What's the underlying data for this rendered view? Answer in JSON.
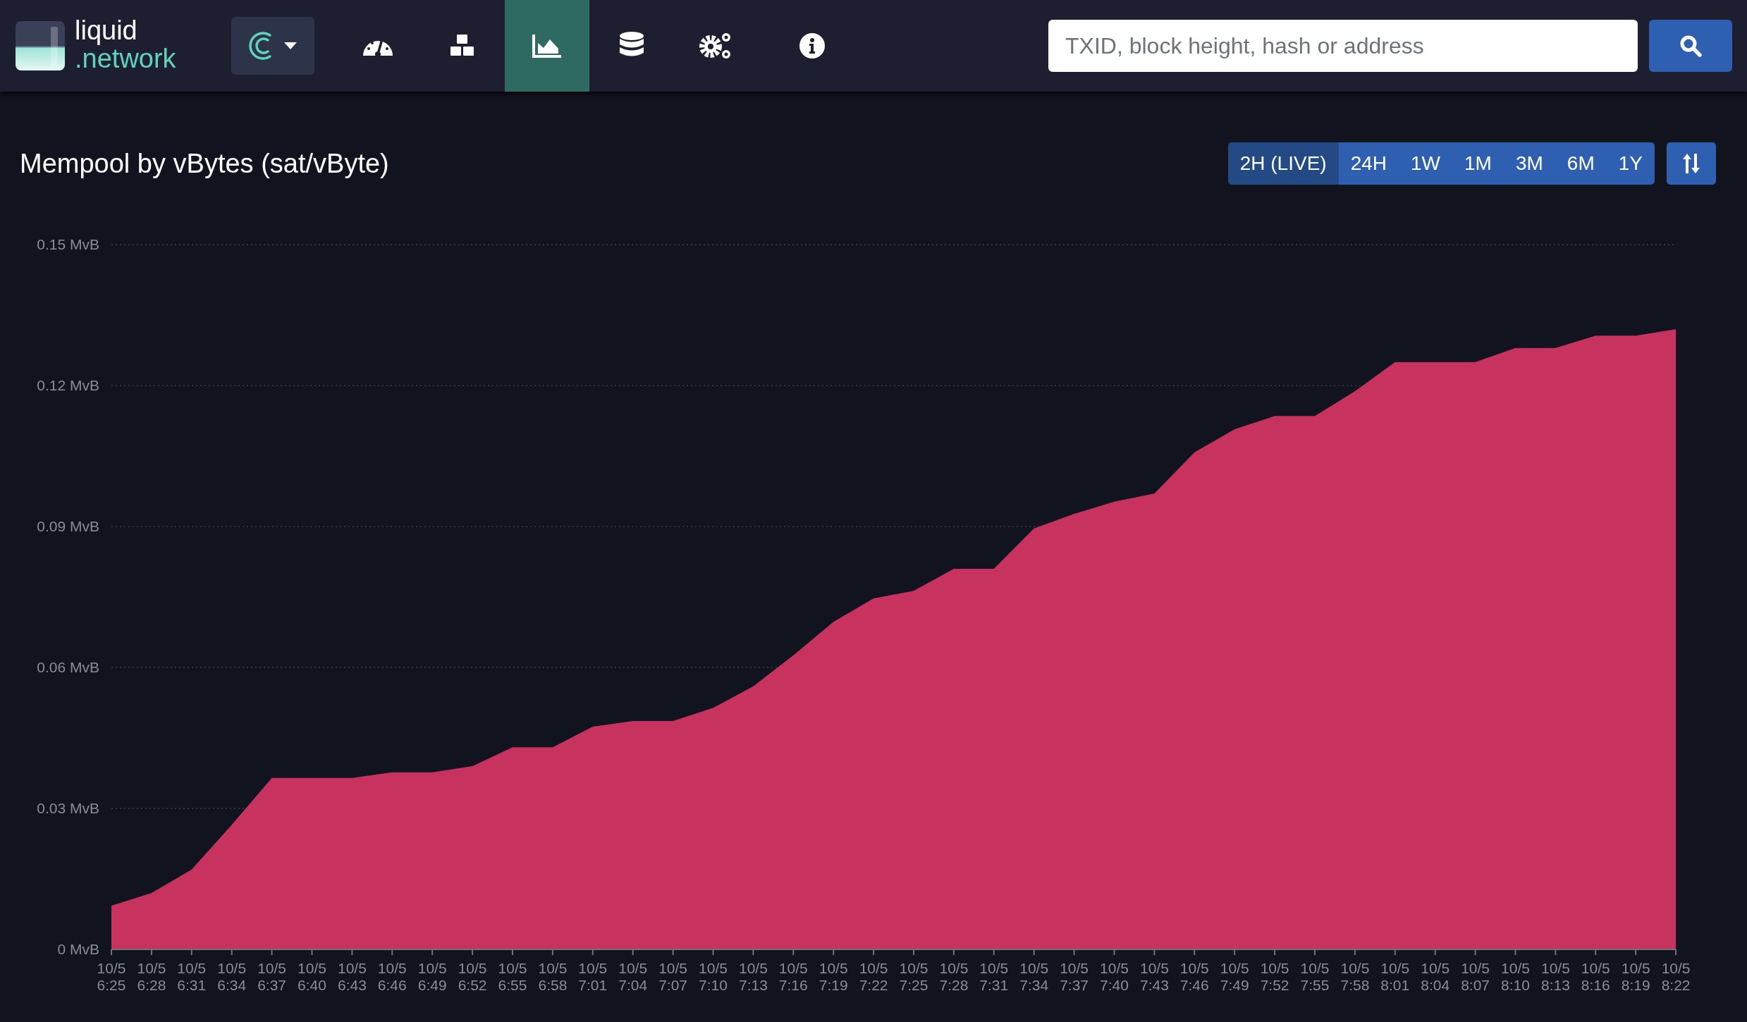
{
  "header": {
    "logo": {
      "line_1": "liquid",
      "line_2": ".network"
    },
    "nav": [
      {
        "kind": "dashboard",
        "selected": false
      },
      {
        "kind": "blocks",
        "selected": false
      },
      {
        "kind": "graphs",
        "selected": true
      },
      {
        "kind": "database",
        "selected": false
      },
      {
        "kind": "tools",
        "selected": false
      },
      {
        "kind": "about",
        "selected": false
      }
    ],
    "search": {
      "placeholder": "TXID, block height, hash or address"
    }
  },
  "page_title": "Mempool by vBytes (sat/vByte)",
  "timespans": [
    {
      "label": "2H (LIVE)",
      "selected": true
    },
    {
      "label": "24H",
      "selected": false
    },
    {
      "label": "1W",
      "selected": false
    },
    {
      "label": "1M",
      "selected": false
    },
    {
      "label": "3M",
      "selected": false
    },
    {
      "label": "6M",
      "selected": false
    },
    {
      "label": "1Y",
      "selected": false
    }
  ],
  "chart_data": {
    "type": "area",
    "categories": [
      "10/5 6:25",
      "10/5 6:28",
      "10/5 6:31",
      "10/5 6:34",
      "10/5 6:37",
      "10/5 6:40",
      "10/5 6:43",
      "10/5 6:46",
      "10/5 6:49",
      "10/5 6:52",
      "10/5 6:55",
      "10/5 6:58",
      "10/5 7:01",
      "10/5 7:04",
      "10/5 7:07",
      "10/5 7:10",
      "10/5 7:13",
      "10/5 7:16",
      "10/5 7:19",
      "10/5 7:22",
      "10/5 7:25",
      "10/5 7:28",
      "10/5 7:31",
      "10/5 7:34",
      "10/5 7:37",
      "10/5 7:40",
      "10/5 7:43",
      "10/5 7:46",
      "10/5 7:49",
      "10/5 7:52",
      "10/5 7:55",
      "10/5 7:58",
      "10/5 8:01",
      "10/5 8:04",
      "10/5 8:07",
      "10/5 8:10",
      "10/5 8:13",
      "10/5 8:16",
      "10/5 8:19",
      "10/5 8:22"
    ],
    "grid": true,
    "series": [
      {
        "color": "#c7335e",
        "values": [
          0.0093,
          0.012,
          0.017,
          0.0265,
          0.0365,
          0.0365,
          0.0365,
          0.0377,
          0.0377,
          0.039,
          0.043,
          0.043,
          0.0474,
          0.0486,
          0.0486,
          0.0514,
          0.056,
          0.0626,
          0.0697,
          0.0747,
          0.0763,
          0.081,
          0.081,
          0.0896,
          0.0927,
          0.0953,
          0.097,
          0.1058,
          0.1107,
          0.1135,
          0.1135,
          0.1188,
          0.125,
          0.125,
          0.125,
          0.128,
          0.128,
          0.1306,
          0.1306,
          0.132
        ]
      }
    ],
    "ylim": [
      0,
      0.15
    ],
    "yticks": [
      {
        "value": 0,
        "label": "0 MvB"
      },
      {
        "value": 0.03,
        "label": "0.03 MvB"
      },
      {
        "value": 0.06,
        "label": "0.06 MvB"
      },
      {
        "value": 0.09,
        "label": "0.09 MvB"
      },
      {
        "value": 0.12,
        "label": "0.12 MvB"
      },
      {
        "value": 0.15,
        "label": "0.15 MvB"
      }
    ]
  }
}
